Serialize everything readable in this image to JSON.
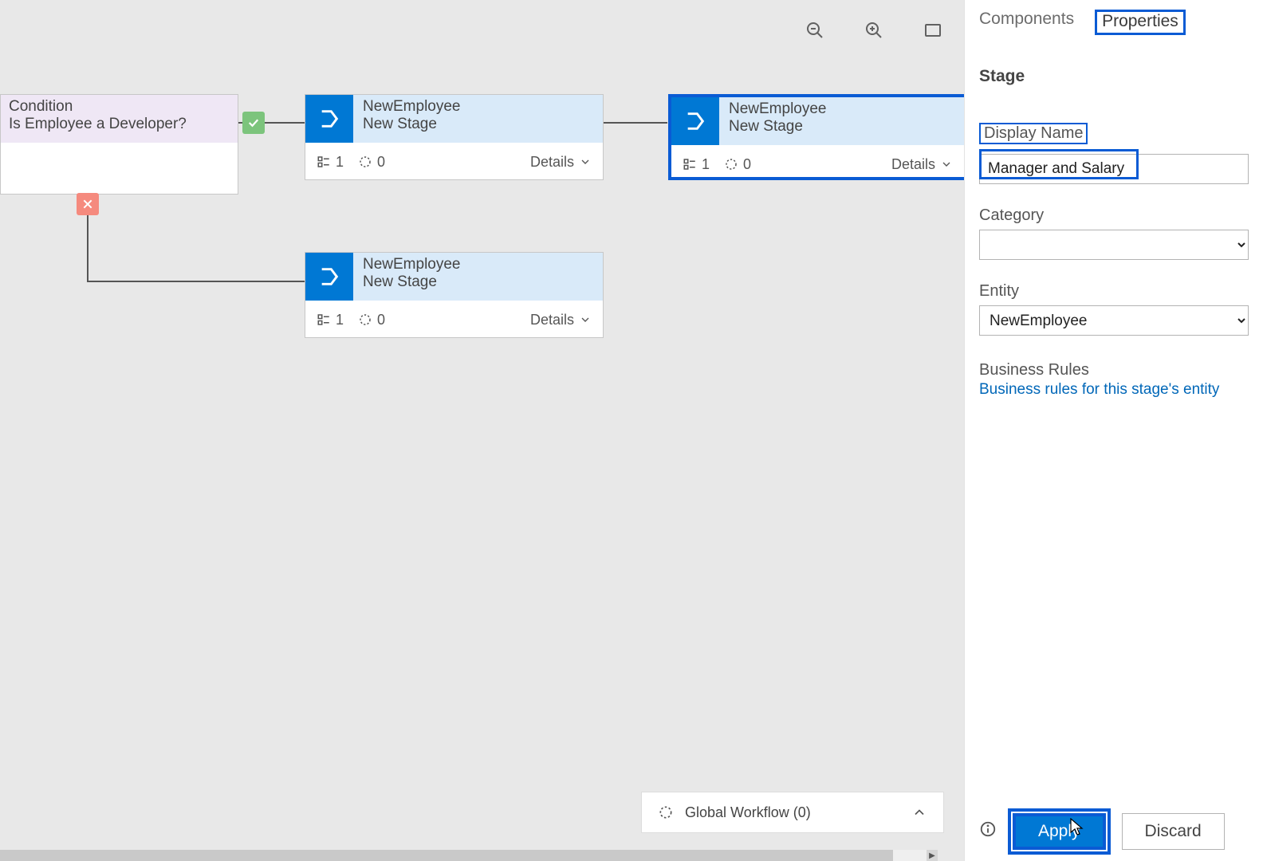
{
  "tabs": {
    "components": "Components",
    "properties": "Properties"
  },
  "panelTitle": "Stage",
  "fields": {
    "displayNameLabel": "Display Name",
    "displayNameValue": "Manager and Salary",
    "categoryLabel": "Category",
    "categoryValue": "",
    "entityLabel": "Entity",
    "entityValue": "NewEmployee"
  },
  "businessRules": {
    "title": "Business Rules",
    "link": "Business rules for this stage's entity"
  },
  "buttons": {
    "apply": "Apply",
    "discard": "Discard"
  },
  "globalWorkflow": "Global Workflow (0)",
  "condition": {
    "label": "Condition",
    "text": "Is Employee a Developer?"
  },
  "stageEntity": "NewEmployee",
  "stageName": "New Stage",
  "detailsLabel": "Details",
  "stepsCount": "1",
  "triggersCount": "0"
}
